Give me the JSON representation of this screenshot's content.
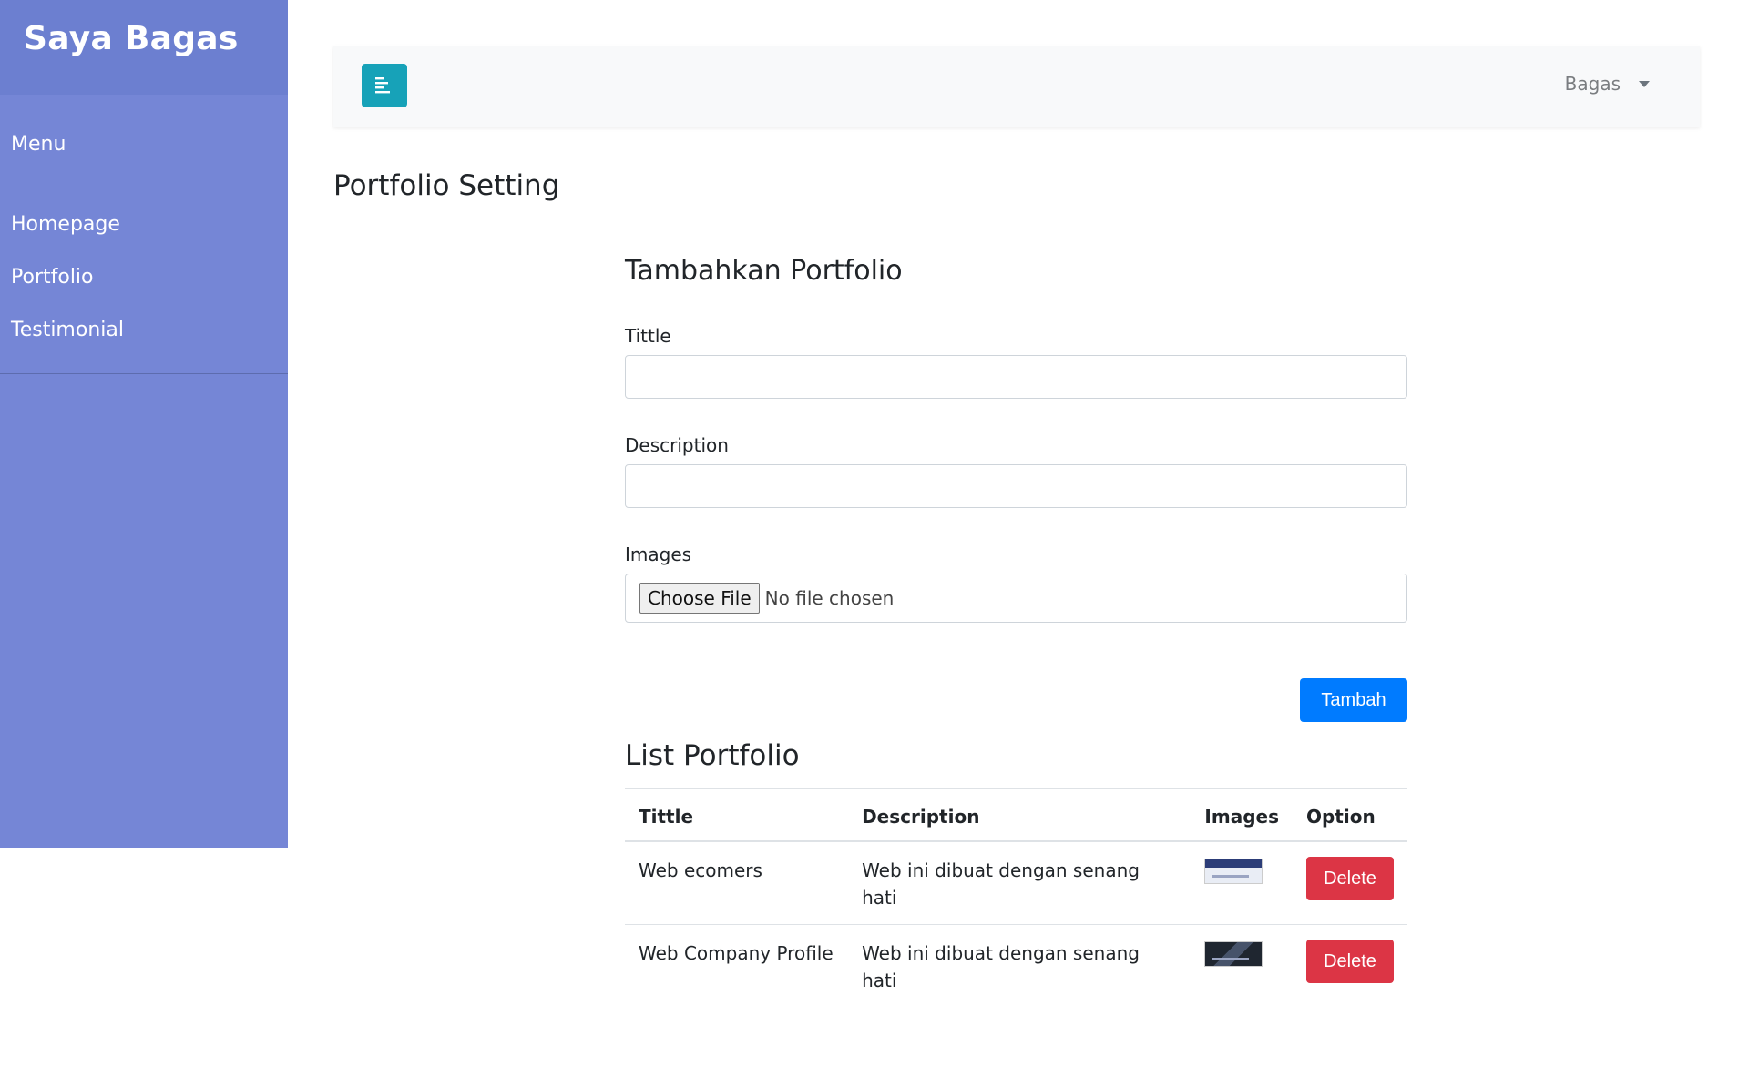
{
  "sidebar": {
    "brand": "Saya Bagas",
    "menu_label": "Menu",
    "items": [
      {
        "label": "Homepage"
      },
      {
        "label": "Portfolio"
      },
      {
        "label": "Testimonial"
      }
    ],
    "bg_color": "#7586d6"
  },
  "topbar": {
    "toggle_icon": "align-left-icon",
    "user_name": "Bagas",
    "toggle_color": "#17a2b8"
  },
  "page": {
    "title": "Portfolio Setting"
  },
  "form": {
    "title": "Tambahkan Portfolio",
    "title_label": "Tittle",
    "title_value": "",
    "description_label": "Description",
    "description_value": "",
    "images_label": "Images",
    "file_button": "Choose File",
    "file_status": "No file chosen",
    "submit_label": "Tambah"
  },
  "list": {
    "title": "List Portfolio",
    "headers": [
      "Tittle",
      "Description",
      "Images",
      "Option"
    ],
    "rows": [
      {
        "title": "Web ecomers",
        "description": "Web ini dibuat dengan senang hati",
        "image": "portfolio-thumbnail",
        "action": "Delete"
      },
      {
        "title": "Web Company Profile",
        "description": "Web ini dibuat dengan senang hati",
        "image": "portfolio-thumbnail",
        "action": "Delete"
      }
    ]
  },
  "colors": {
    "primary": "#007bff",
    "danger": "#dc3545"
  }
}
